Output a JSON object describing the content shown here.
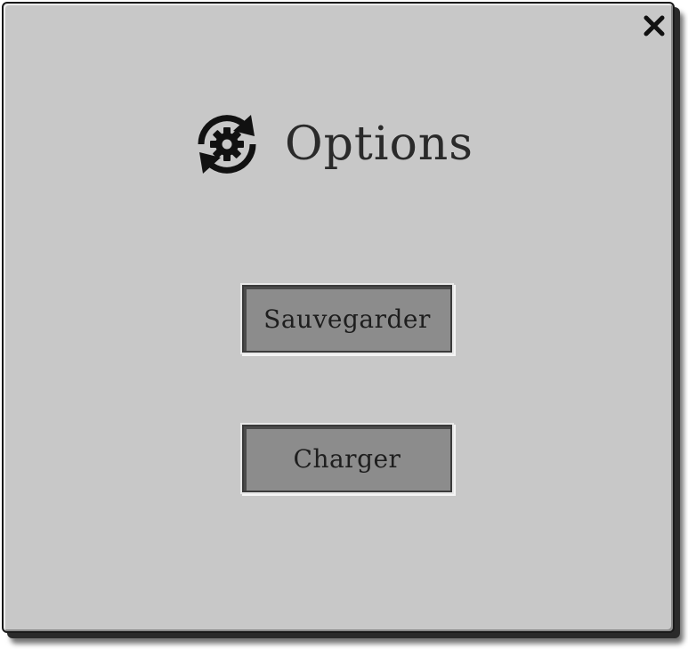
{
  "dialog": {
    "title": "Options",
    "title_icon": "settings-sync-icon",
    "close_icon": "close-icon"
  },
  "buttons": {
    "save_label": "Sauvegarder",
    "load_label": "Charger"
  },
  "colors": {
    "panel": "#c8c8c8",
    "button": "#8c8c8c",
    "text": "#2a2a2a"
  }
}
